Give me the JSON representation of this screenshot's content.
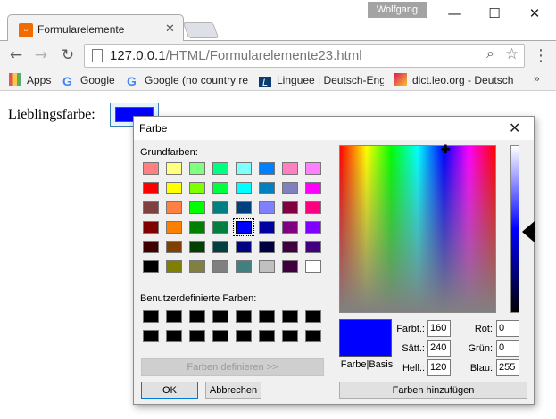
{
  "browser": {
    "profile_name": "Wolfgang",
    "tab": {
      "title": "Formularelemente"
    },
    "url": {
      "host": "127.0.0.1",
      "path": "/HTML/Formularelemente23.html"
    },
    "bookmarks": [
      "Apps",
      "Google",
      "Google (no country re",
      "Linguee | Deutsch-Eng",
      "dict.leo.org - Deutsch"
    ]
  },
  "page": {
    "label": "Lieblingsfarbe:",
    "color_value": "#0000ff"
  },
  "dialog": {
    "title": "Farbe",
    "basic_colors_label": "Grundfarben:",
    "custom_colors_label": "Benutzerdefinierte Farben:",
    "define_button": "Farben definieren >>",
    "ok_button": "OK",
    "cancel_button": "Abbrechen",
    "add_button": "Farben hinzufügen",
    "preview_label": "Farbe|Basis",
    "hue_label": "Farbt.:",
    "sat_label": "Sätt.:",
    "lum_label": "Hell.:",
    "red_label": "Rot:",
    "green_label": "Grün:",
    "blue_label": "Blau:",
    "hue": "160",
    "sat": "240",
    "lum": "120",
    "red": "0",
    "green": "0",
    "blue": "255",
    "basic_colors": [
      [
        "#ff8080",
        "#ffff80",
        "#80ff80",
        "#00ff80",
        "#80ffff",
        "#0080ff",
        "#ff80c0",
        "#ff80ff"
      ],
      [
        "#ff0000",
        "#ffff00",
        "#80ff00",
        "#00ff40",
        "#00ffff",
        "#0080c0",
        "#8080c0",
        "#ff00ff"
      ],
      [
        "#804040",
        "#ff8040",
        "#00ff00",
        "#008080",
        "#004080",
        "#8080ff",
        "#800040",
        "#ff0080"
      ],
      [
        "#800000",
        "#ff8000",
        "#008000",
        "#008040",
        "#0000ff",
        "#0000a0",
        "#800080",
        "#8000ff"
      ],
      [
        "#400000",
        "#804000",
        "#004000",
        "#004040",
        "#000080",
        "#000040",
        "#400040",
        "#400080"
      ],
      [
        "#000000",
        "#808000",
        "#808040",
        "#808080",
        "#408080",
        "#c0c0c0",
        "#400040",
        "#ffffff"
      ]
    ],
    "selected_color": "#0000ff",
    "custom_colors": [
      [
        "#000000",
        "#000000",
        "#000000",
        "#000000",
        "#000000",
        "#000000",
        "#000000",
        "#000000"
      ],
      [
        "#000000",
        "#000000",
        "#000000",
        "#000000",
        "#000000",
        "#000000",
        "#000000",
        "#000000"
      ]
    ]
  }
}
